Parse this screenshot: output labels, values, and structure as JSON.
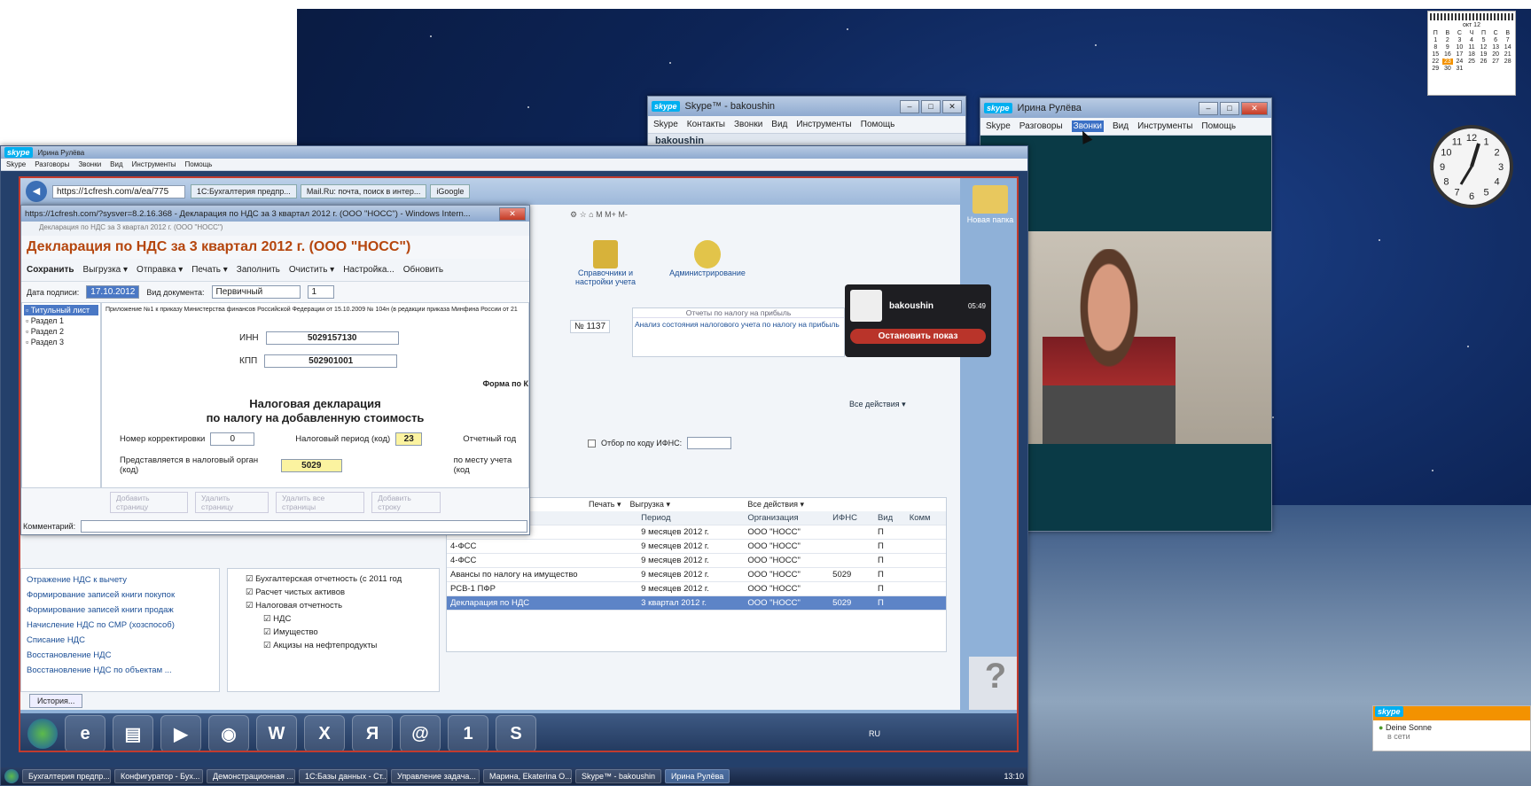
{
  "desktop": {
    "calendar": {
      "month": "окт 12",
      "weekdays": [
        "П",
        "В",
        "С",
        "Ч",
        "П",
        "С",
        "В"
      ],
      "rows": [
        [
          "1",
          "2",
          "3",
          "4",
          "5",
          "6",
          "7"
        ],
        [
          "8",
          "9",
          "10",
          "11",
          "12",
          "13",
          "14"
        ],
        [
          "15",
          "16",
          "17",
          "18",
          "19",
          "20",
          "21"
        ],
        [
          "22",
          "23",
          "24",
          "25",
          "26",
          "27",
          "28"
        ],
        [
          "29",
          "30",
          "31",
          "",
          "",
          "",
          ""
        ]
      ]
    },
    "clock_numbers": [
      "12",
      "1",
      "2",
      "3",
      "4",
      "5",
      "6",
      "7",
      "8",
      "9",
      "10",
      "11"
    ],
    "skype_toast": {
      "name": "Deine Sonne",
      "status": "в сети"
    },
    "new_folder": "Новая папка"
  },
  "skype_bak": {
    "title": "Skype™ - bakoushin",
    "menu": [
      "Skype",
      "Контакты",
      "Звонки",
      "Вид",
      "Инструменты",
      "Помощь"
    ],
    "user": "bakoushin"
  },
  "skype_irina": {
    "title": "Ирина Рулёва",
    "menu": [
      "Skype",
      "Разговоры",
      "Звонки",
      "Вид",
      "Инструменты",
      "Помощь"
    ]
  },
  "outer": {
    "title": "Ирина Рулёва",
    "menu": [
      "Skype",
      "Разговоры",
      "Звонки",
      "Вид",
      "Инструменты",
      "Помощь"
    ]
  },
  "browser": {
    "url": "https://1cfresh.com/a/ea/775",
    "tabs": [
      "1С:Бухгалтерия предпр...",
      "Mail.Ru: почта, поиск в интер...",
      "iGoogle"
    ],
    "sections": [
      "Справочники и настройки учета",
      "Администрирование"
    ],
    "share": {
      "name": "bakoushin",
      "time": "05:49",
      "stop": "Остановить показ"
    },
    "panel_title": "Отчеты по налогу на прибыль",
    "panel_text": "Анализ состояния налогового учета по налогу на прибыль",
    "doc_num": "№ 1137",
    "all_actions": "Все действия ▾",
    "filter_label": "Отбор по коду ИФНС:",
    "print": "Печать ▾",
    "upload": "Выгрузка ▾",
    "columns": [
      "Период",
      "Организация",
      "ИФНС",
      "Вид",
      "Комм"
    ],
    "rows": [
      {
        "name": "",
        "period": "9 месяцев 2012 г.",
        "org": "ООО \"НОСС\"",
        "ifns": "",
        "kind": "П"
      },
      {
        "name": "4-ФСС",
        "period": "9 месяцев 2012 г.",
        "org": "ООО \"НОСС\"",
        "ifns": "",
        "kind": "П"
      },
      {
        "name": "4-ФСС",
        "period": "9 месяцев 2012 г.",
        "org": "ООО \"НОСС\"",
        "ifns": "",
        "kind": "П"
      },
      {
        "name": "Авансы по налогу на имущество",
        "period": "9 месяцев 2012 г.",
        "org": "ООО \"НОСС\"",
        "ifns": "5029",
        "kind": "П"
      },
      {
        "name": "РСВ-1 ПФР",
        "period": "9 месяцев 2012 г.",
        "org": "ООО \"НОСС\"",
        "ifns": "",
        "kind": "П"
      },
      {
        "name": "Декларация по НДС",
        "period": "3 квартал 2012 г.",
        "org": "ООО \"НОСС\"",
        "ifns": "5029",
        "kind": "П"
      }
    ],
    "left_links": [
      "Отражение НДС к вычету",
      "Формирование записей книги покупок",
      "Формирование записей книги продаж",
      "Начисление НДС по СМР (хозспособ)",
      "Списание НДС",
      "Восстановление НДС",
      "Восстановление НДС по объектам ..."
    ],
    "tree": [
      "Бухгалтерская отчетность (с 2011 год",
      "Расчет чистых активов",
      "Налоговая отчетность",
      "НДС",
      "Имущество",
      "Акцизы на нефтепродукты"
    ],
    "history": "История..."
  },
  "dialog": {
    "title": "https://1cfresh.com/?sysver=8.2.16.368 - Декларация по НДС за 3 квартал 2012 г. (ООО \"НОСС\") - Windows Intern...",
    "heading": "Декларация по НДС за 3 квартал 2012 г. (ООО \"НОСС\")",
    "toolbar": [
      "Сохранить",
      "Выгрузка ▾",
      "Отправка ▾",
      "Печать ▾",
      "Заполнить",
      "Очистить ▾",
      "Настройка...",
      "Обновить"
    ],
    "date_label": "Дата подписи:",
    "date": "17.10.2012",
    "doctype_label": "Вид документа:",
    "doctype": "Первичный",
    "num": "1",
    "tree": [
      "Титульный лист",
      "Раздел 1",
      "Раздел 2",
      "Раздел 3"
    ],
    "appendix": "Приложение №1 к приказу Министерства финансов Российской Федерации от 15.10.2009 № 104н (в редакции приказа Минфина России от 21",
    "inn_label": "ИНН",
    "inn": "5029157130",
    "kpp_label": "КПП",
    "kpp": "502901001",
    "form_label": "Форма по К",
    "title1": "Налоговая декларация",
    "title2": "по налогу на добавленную стоимость",
    "corr_label": "Номер корректировки",
    "corr": "0",
    "period_label": "Налоговый период (код)",
    "period": "23",
    "year_label": "Отчетный год",
    "organ_label": "Представляется в налоговый орган (код)",
    "organ": "5029",
    "place_label": "по месту учета (код",
    "page_btns": [
      "Добавить страницу",
      "Удалить страницу",
      "Удалить все страницы",
      "Добавить строку"
    ],
    "comment_label": "Комментарий:"
  },
  "taskbar_inner": {
    "lang": "RU"
  },
  "taskbar": {
    "items": [
      "Бухгалтерия предпр...",
      "Конфигуратор - Бух...",
      "Демонстрационная ...",
      "1С:Базы данных - Ст...",
      "Управление задача...",
      "Марина, Ekaterina O...",
      "Skype™ - bakoushin",
      "Ирина Рулёва"
    ],
    "time": "13:10"
  }
}
